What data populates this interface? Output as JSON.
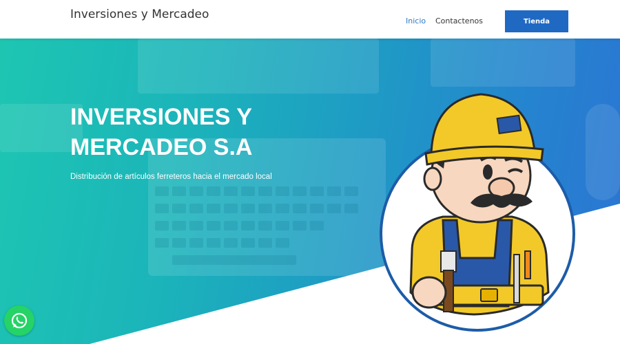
{
  "header": {
    "brand": "Inversiones y Mercadeo",
    "nav": [
      {
        "label": "Inicio",
        "active": true
      },
      {
        "label": "Contactenos",
        "active": false
      }
    ],
    "shop_label": "Tienda"
  },
  "hero": {
    "title_line1": "INVERSIONES Y",
    "title_line2": "MERCADEO S.A",
    "subtitle": "Distribución de artículos ferreteros hacia el mercado local"
  },
  "colors": {
    "accent": "#1f69c3",
    "active_link": "#2a78c4",
    "hero_gradient_start": "#1ec6b2",
    "hero_gradient_end": "#2b74d3",
    "whatsapp": "#25d366"
  },
  "icons": {
    "whatsapp": "whatsapp-icon",
    "mascot": "handyman-mascot-illustration"
  }
}
